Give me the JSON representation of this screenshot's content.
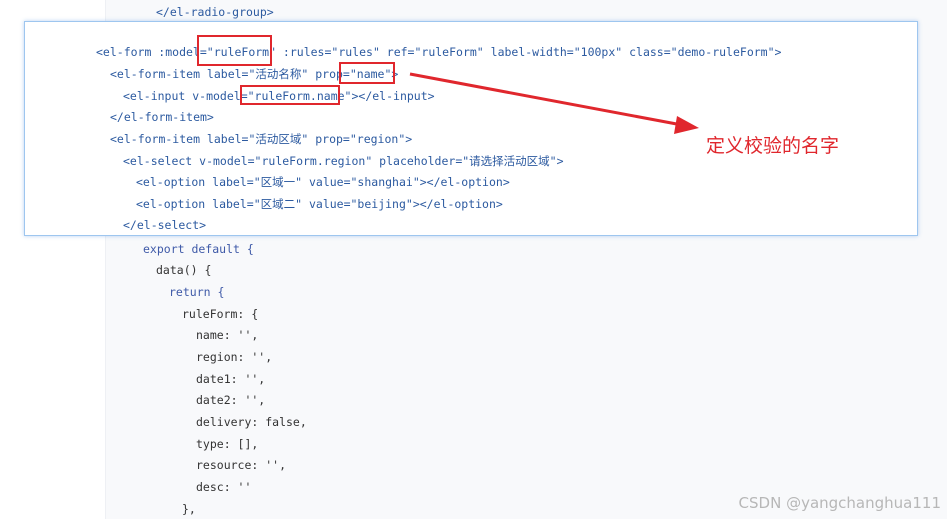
{
  "top_code": {
    "line0": "</el-radio-group>"
  },
  "overlay": {
    "lines": [
      "<el-form :model=\"ruleForm\" :rules=\"rules\" ref=\"ruleForm\" label-width=\"100px\" class=\"demo-ruleForm\">",
      "<el-form-item label=\"活动名称\" prop=\"name\">",
      "<el-input v-model=\"ruleForm.name\"></el-input>",
      "</el-form-item>",
      "<el-form-item label=\"活动区域\" prop=\"region\">",
      "<el-select v-model=\"ruleForm.region\" placeholder=\"请选择活动区域\">",
      "<el-option label=\"区域一\" value=\"shanghai\"></el-option>",
      "<el-option label=\"区域二\" value=\"beijing\"></el-option>",
      "</el-select>"
    ]
  },
  "bottom_code": {
    "lines": [
      "export default {",
      "data() {",
      "return {",
      "ruleForm: {",
      "name: '',",
      "region: '',",
      "date1: '',",
      "date2: '',",
      "delivery: false,",
      "type: [],",
      "resource: '',",
      "desc: ''",
      "},"
    ]
  },
  "annotation": {
    "text": "定义校验的名字",
    "color": "#e0272d"
  },
  "watermark": {
    "text": "CSDN @yangchanghua111"
  },
  "colors": {
    "highlight_border": "#9ec6ef",
    "red": "#e0272d",
    "code_blue": "#2c5aa0"
  }
}
